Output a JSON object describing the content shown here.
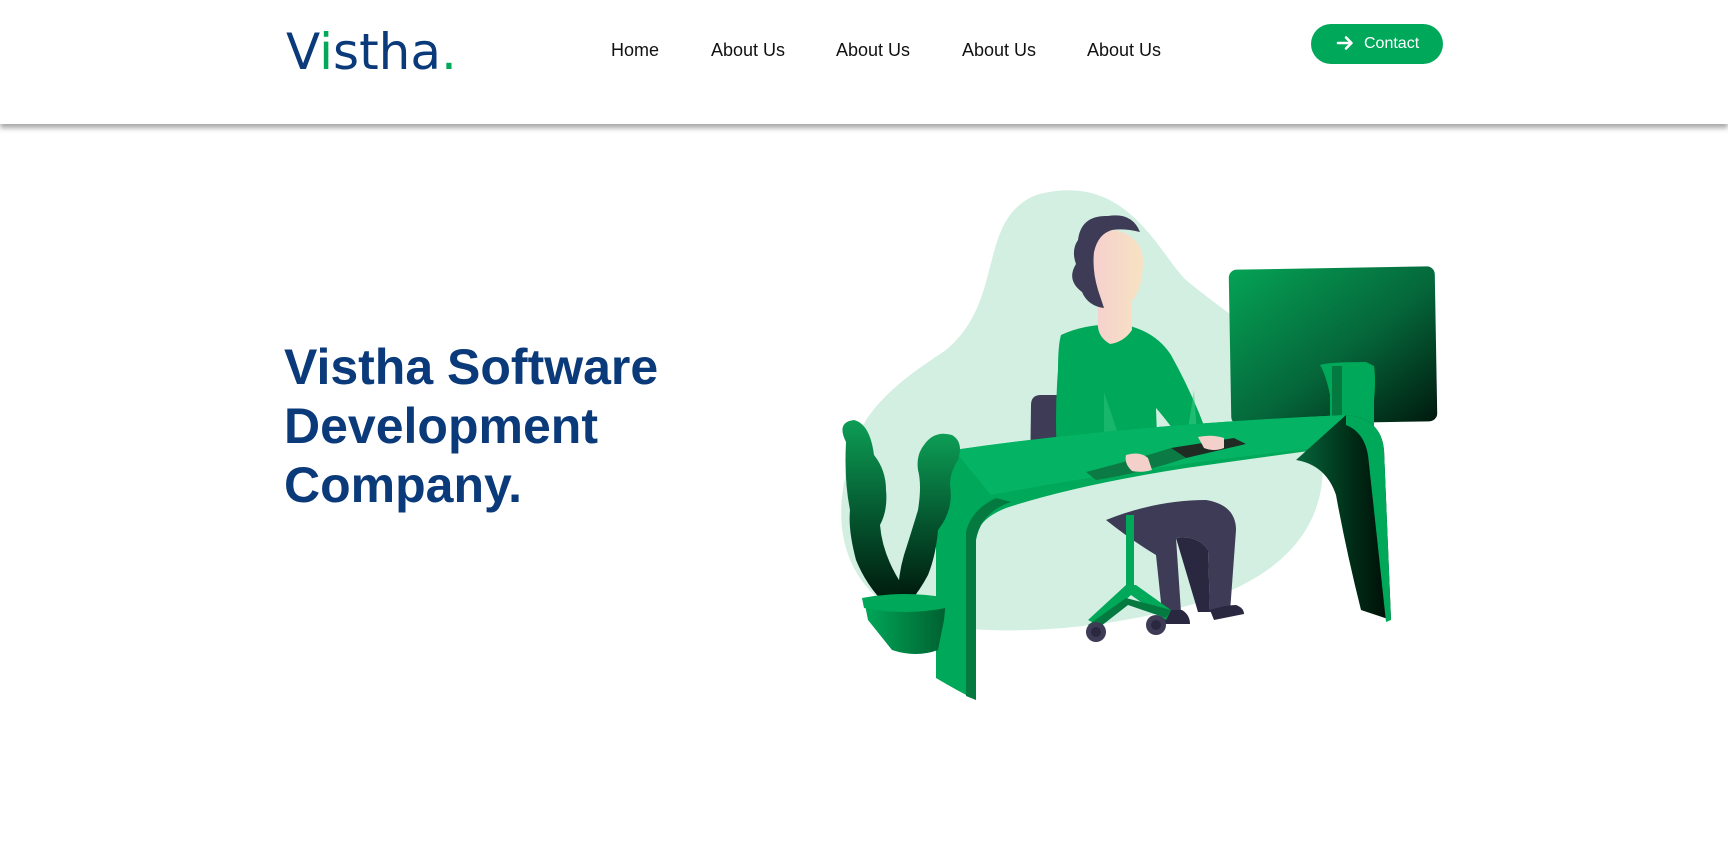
{
  "brand": {
    "logo_prefix": "V",
    "logo_i": "i",
    "logo_rest": "stha",
    "logo_dot": "."
  },
  "nav": {
    "items": [
      {
        "label": "Home"
      },
      {
        "label": "About Us"
      },
      {
        "label": "About Us"
      },
      {
        "label": "About Us"
      },
      {
        "label": "About Us"
      }
    ]
  },
  "header": {
    "contact_label": "Contact",
    "contact_icon": "arrow-right-icon"
  },
  "hero": {
    "title_line1": "Vistha Software",
    "title_line2": "Development",
    "title_line3": "Company."
  },
  "colors": {
    "brand_blue": "#0b3a7a",
    "accent_green": "#00a859",
    "blob_mint": "#d3efe2",
    "dark_purple": "#3d3b55"
  },
  "illustration": {
    "subject": "person-at-desk-illustration"
  }
}
